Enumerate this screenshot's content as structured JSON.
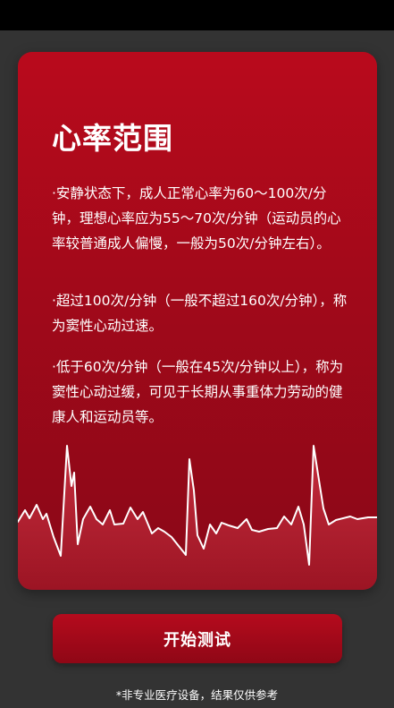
{
  "card": {
    "title": "心率范围",
    "paragraphs": [
      "·安静状态下，成人正常心率为60～100次/分钟，理想心率应为55～70次/分钟（运动员的心率较普通成人偏慢，一般为50次/分钟左右）。",
      "·超过100次/分钟（一般不超过160次/分钟），称为窦性心动过速。",
      "·低于60次/分钟（一般在45次/分钟以上），称为窦性心动过缓，可见于长期从事重体力劳动的健康人和运动员等。"
    ],
    "illustration": "ecg-heartbeat-line"
  },
  "start_button_label": "开始测试",
  "disclaimer": "*非专业医疗设备，结果仅供参考",
  "colors": {
    "background": "#333333",
    "card_red": "#b90a1c",
    "button_red": "#a50a1a",
    "text": "#ffffff"
  }
}
